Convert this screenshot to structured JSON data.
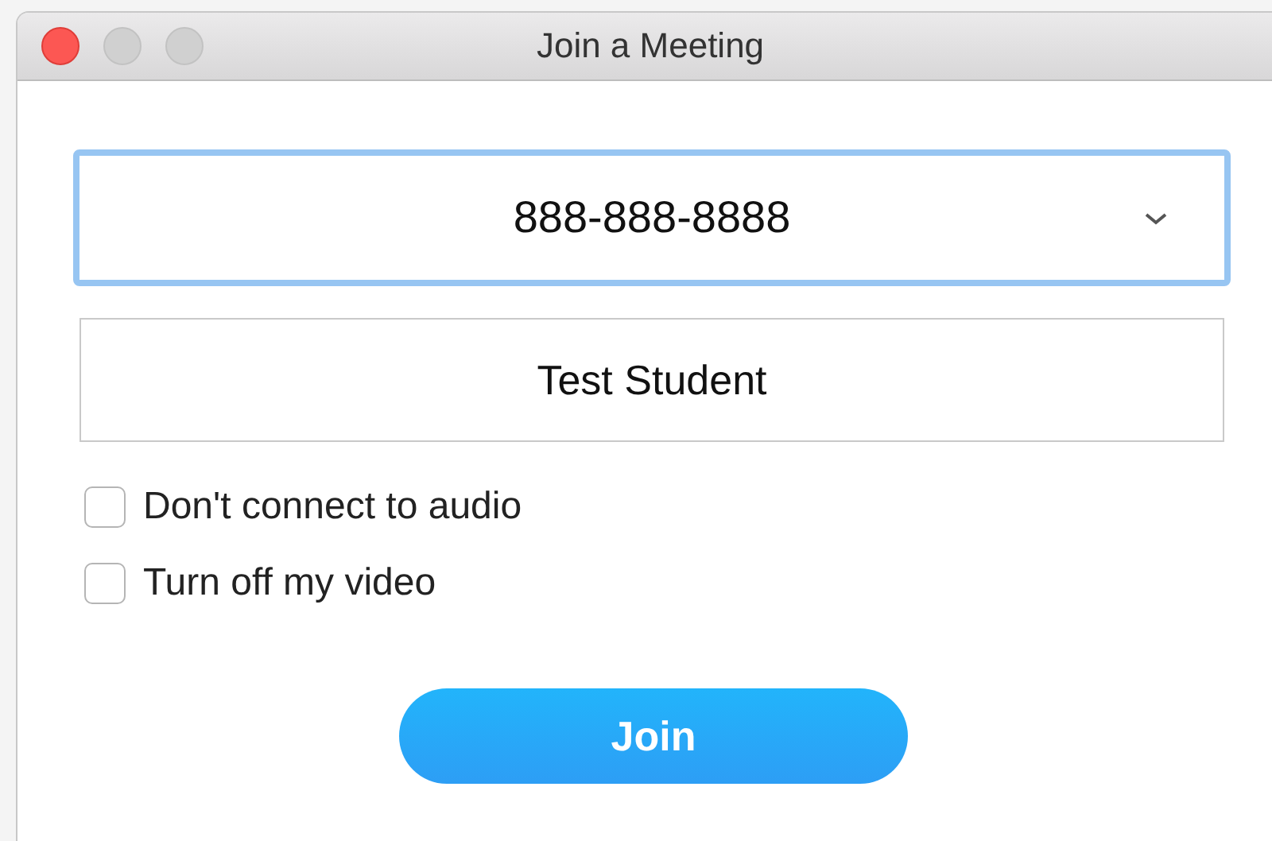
{
  "window": {
    "title": "Join a Meeting"
  },
  "meeting_id": {
    "value": "888-888-8888",
    "focused": true
  },
  "name_field": {
    "value": "Test Student"
  },
  "options": [
    {
      "label": "Don't connect to audio",
      "checked": false
    },
    {
      "label": "Turn off my video",
      "checked": false
    }
  ],
  "join_button": {
    "label": "Join"
  }
}
